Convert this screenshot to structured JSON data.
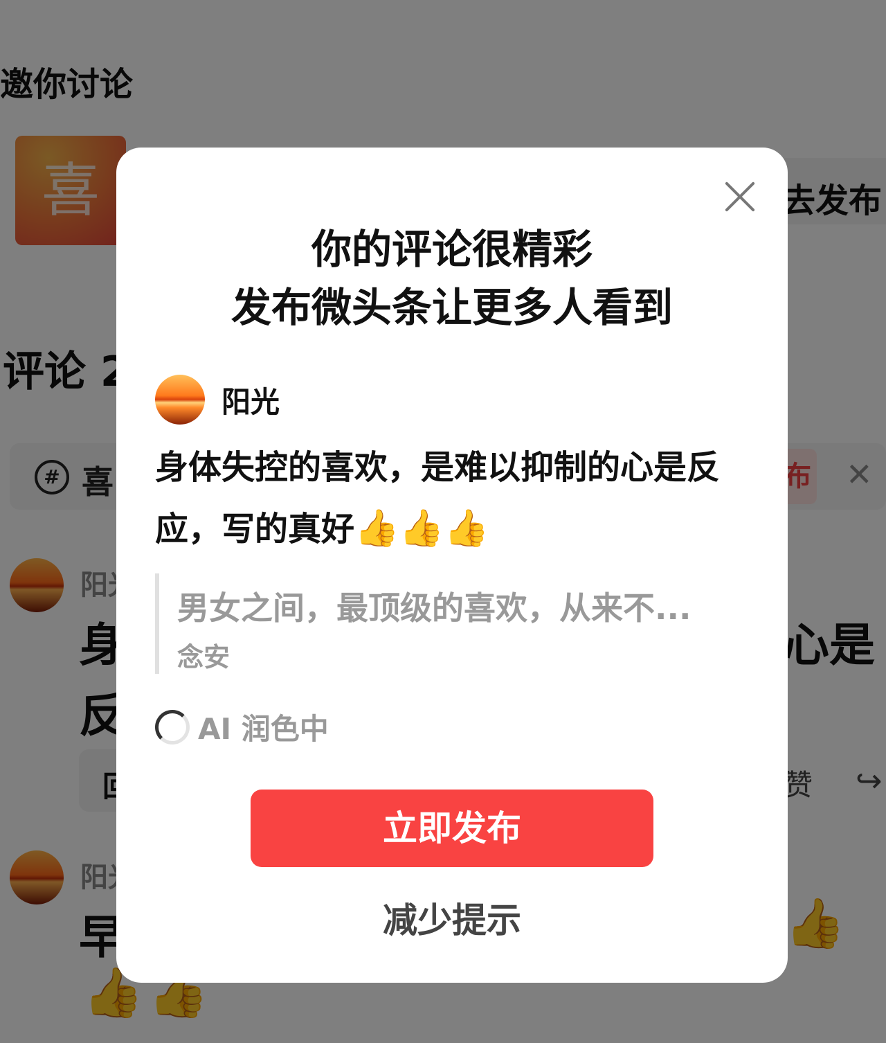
{
  "background": {
    "invite_title": "邀你讨论",
    "thumbnail_glyph": "喜",
    "publish_chip": "去发布",
    "comments_heading": "评论 2",
    "topic": {
      "text": "喜",
      "publish": "布",
      "close": "✕"
    },
    "comments": [
      {
        "name": "阳光",
        "body_line1": "身",
        "body_line1_end": "心是",
        "body_line2": "反"
      },
      {
        "name": "阳光",
        "body_line1": "早"
      }
    ],
    "reply_label": "回",
    "like_label": "赞",
    "share_icon": "↪",
    "thumbs_emoji": "👍"
  },
  "dialog": {
    "title_line1": "你的评论很精彩",
    "title_line2": "发布微头条让更多人看到",
    "user_name": "阳光",
    "comment_text": "身体失控的喜欢，是难以抑制的心是反应，写的真好",
    "comment_emojis": "👍👍👍",
    "quote_text": "男女之间，最顶级的喜欢，从来不...",
    "quote_author": "念安",
    "ai_status": "AI 润色中",
    "publish_button": "立即发布",
    "reduce_button": "减少提示"
  }
}
